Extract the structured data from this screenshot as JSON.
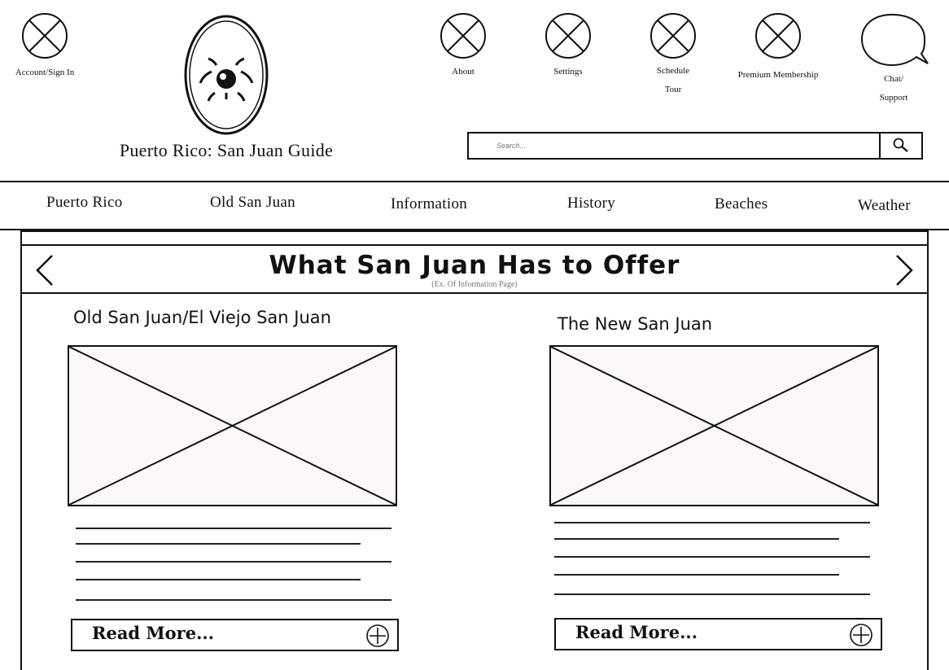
{
  "header": {
    "account": {
      "label": "Account/Sign In",
      "icon": "placeholder-x-icon"
    },
    "logo": {
      "icon": "san-juan-guide-logo",
      "text": "San Juan Guide"
    },
    "site_title": "Puerto Rico: San Juan Guide",
    "top_links": [
      {
        "label": "About",
        "icon": "placeholder-x-icon"
      },
      {
        "label": "Settings",
        "icon": "placeholder-x-icon"
      },
      {
        "label": "Schedule Tour",
        "icon": "placeholder-x-icon"
      },
      {
        "label": "Premium Membership",
        "icon": "placeholder-x-icon"
      }
    ],
    "chat": {
      "label": "Chat/ Support",
      "icon": "speech-bubble-icon"
    },
    "search": {
      "placeholder": "Search...",
      "icon": "search-icon"
    }
  },
  "nav": {
    "items": [
      {
        "label": "Puerto Rico"
      },
      {
        "label": "Old San Juan"
      },
      {
        "label": "Information"
      },
      {
        "label": "History"
      },
      {
        "label": "Beaches"
      },
      {
        "label": "Weather"
      }
    ]
  },
  "banner": {
    "title": "What San Juan Has to Offer",
    "subtitle": "(Ex. Of Information Page)",
    "prev_icon": "chevron-left-icon",
    "next_icon": "chevron-right-icon"
  },
  "columns": [
    {
      "title": "Old San Juan/El Viejo San Juan",
      "read_more": "Read More...",
      "image_icon": "image-placeholder-icon"
    },
    {
      "title": "The New San Juan",
      "read_more": "Read More...",
      "image_icon": "image-placeholder-icon"
    }
  ],
  "colors": {
    "stroke": "#111111",
    "image_fill": "#fcf8fa",
    "muted_text": "#777777"
  }
}
